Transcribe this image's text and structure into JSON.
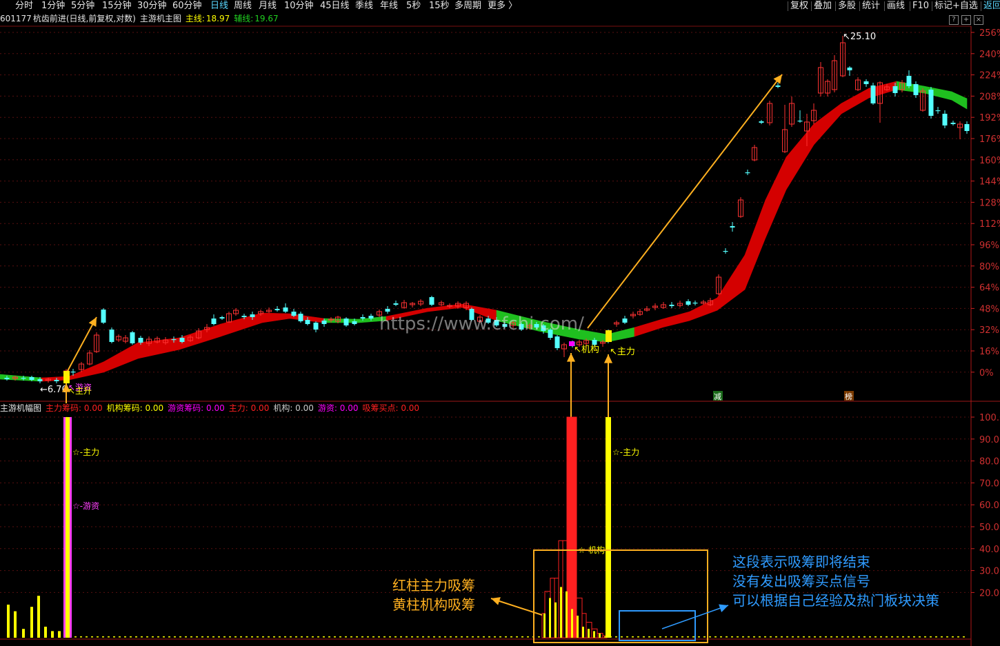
{
  "toolbar": {
    "periods": [
      "分时",
      "1分钟",
      "5分钟",
      "15分钟",
      "30分钟",
      "60分钟",
      "日线",
      "周线",
      "月线",
      "10分钟",
      "45日线",
      "季线",
      "年线",
      "5秒",
      "15秒",
      "多周期",
      "更多 〉"
    ],
    "active_period": "日线",
    "right_buttons": [
      "复权",
      "叠加",
      "多股",
      "统计",
      "画线",
      "F10",
      "标记+自选",
      "返回"
    ]
  },
  "stock": {
    "code": "601177",
    "name": "杭齿前进",
    "params": "(日线,前复权,对数)",
    "indicator": "主游机主图",
    "main_line_label": "主线:",
    "main_line_value": "18.97",
    "aux_line_label": "辅线:",
    "aux_line_value": "19.67"
  },
  "price_axis": [
    "256%",
    "240%",
    "224%",
    "208%",
    "192%",
    "176%",
    "160%",
    "144%",
    "128%",
    "112%",
    "96%",
    "80%",
    "64%",
    "48%",
    "32%",
    "16%",
    "0%"
  ],
  "price_annotations": {
    "high": "25.10",
    "low": "6.70",
    "youzi": "游资",
    "zhusheng": "主升",
    "jigou": "机构",
    "zhuli": "主力",
    "watermark": "https://www.cfchi.com/",
    "badge1": "减",
    "badge2": "榜"
  },
  "lower_panel": {
    "title": "主游机幅图",
    "items": [
      {
        "label": "主力筹码:",
        "value": "0.00",
        "color": "#ff2020"
      },
      {
        "label": "机构筹码:",
        "value": "0.00",
        "color": "#ffff00"
      },
      {
        "label": "游资筹码:",
        "value": "0.00",
        "color": "#ff00ff"
      },
      {
        "label": "主力:",
        "value": "0.00",
        "color": "#ff2020"
      },
      {
        "label": "机构:",
        "value": "0.00",
        "color": "#cccccc"
      },
      {
        "label": "游资:",
        "value": "0.00",
        "color": "#ff00ff"
      },
      {
        "label": "吸筹买点:",
        "value": "0.00",
        "color": "#ff2020"
      }
    ],
    "axis": [
      "100.00",
      "90.00",
      "80.00",
      "70.00",
      "60.00",
      "50.00",
      "40.00",
      "30.00",
      "20.00"
    ],
    "mark_zhuli": "☆-主力",
    "mark_youzi": "☆-游资",
    "mark_jigou": "☆-机构"
  },
  "annotations": {
    "left_text": [
      "红柱主力吸筹",
      "黄柱机构吸筹"
    ],
    "right_text": [
      "这段表示吸筹即将结束",
      "没有发出吸筹买点信号",
      "可以根据自己经验及热门板块决策"
    ]
  },
  "colors": {
    "up": "#ff3232",
    "down": "#54ffff",
    "band_red": "#d40000",
    "band_green": "#1fbf1f",
    "axis": "#d02020",
    "annotation_orange": "#ffb020",
    "annotation_blue": "#2f9bff"
  }
}
